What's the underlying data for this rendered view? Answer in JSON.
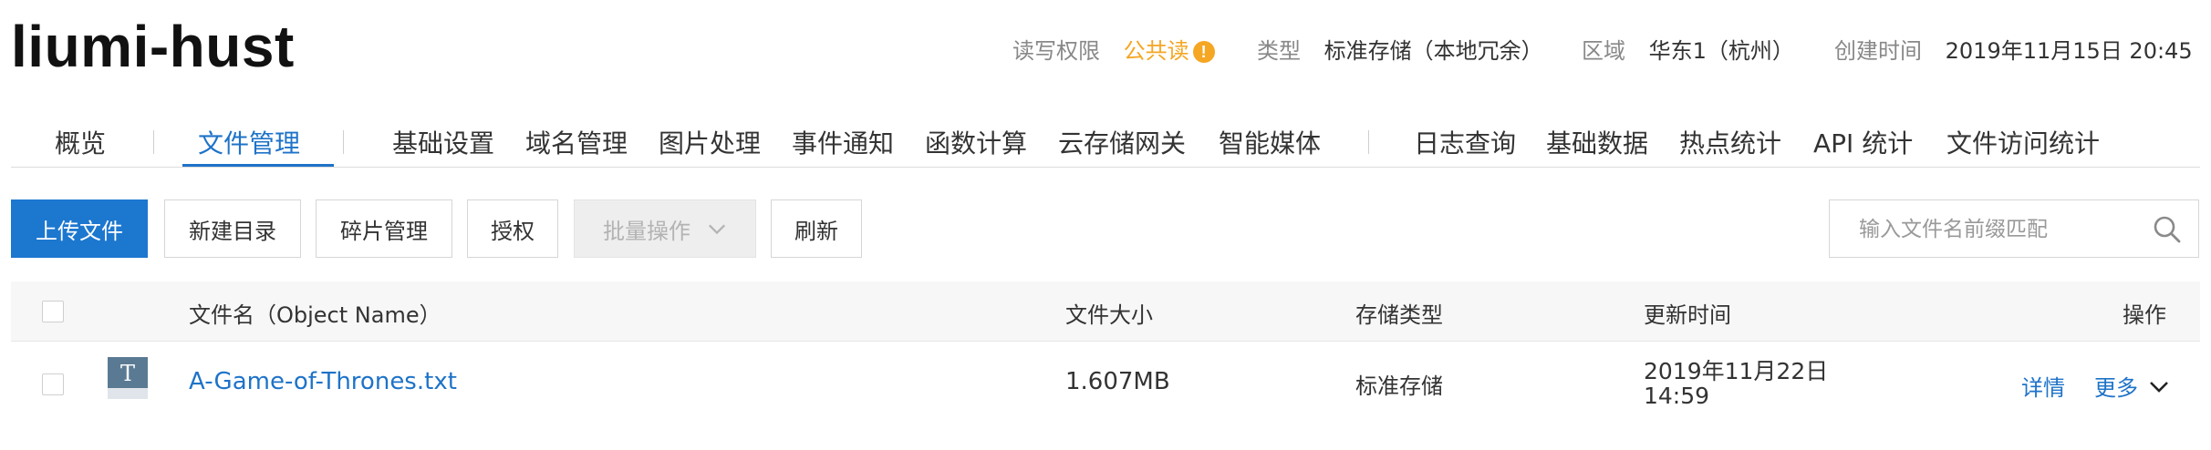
{
  "header": {
    "bucket_name": "liumi-hust",
    "acl_label": "读写权限",
    "acl_value": "公共读",
    "acl_warn_icon": "!",
    "type_label": "类型",
    "type_value": "标准存储（本地冗余）",
    "region_label": "区域",
    "region_value": "华东1（杭州）",
    "created_label": "创建时间",
    "created_value": "2019年11月15日 20:45"
  },
  "tabs": [
    {
      "label": "概览"
    },
    {
      "label": "文件管理"
    },
    {
      "label": "基础设置"
    },
    {
      "label": "域名管理"
    },
    {
      "label": "图片处理"
    },
    {
      "label": "事件通知"
    },
    {
      "label": "函数计算"
    },
    {
      "label": "云存储网关"
    },
    {
      "label": "智能媒体"
    },
    {
      "label": "日志查询"
    },
    {
      "label": "基础数据"
    },
    {
      "label": "热点统计"
    },
    {
      "label": "API 统计"
    },
    {
      "label": "文件访问统计"
    }
  ],
  "active_tab": "文件管理",
  "toolbar": {
    "upload": "上传文件",
    "new_dir": "新建目录",
    "fragments": "碎片管理",
    "authorize": "授权",
    "batch": "批量操作",
    "refresh": "刷新",
    "search_placeholder": "输入文件名前缀匹配"
  },
  "table": {
    "columns": {
      "name": "文件名（Object Name）",
      "size": "文件大小",
      "storage": "存储类型",
      "updated": "更新时间",
      "actions": "操作"
    },
    "rows": [
      {
        "icon_letter": "T",
        "name": "A-Game-of-Thrones.txt",
        "size": "1.607MB",
        "storage": "标准存储",
        "updated_date": "2019年11月22日",
        "updated_time": "14:59",
        "detail": "详情",
        "more": "更多"
      }
    ]
  },
  "colors": {
    "accent": "#1e73c8",
    "warning": "#f5a623",
    "primary_button": "#1c77cf"
  }
}
